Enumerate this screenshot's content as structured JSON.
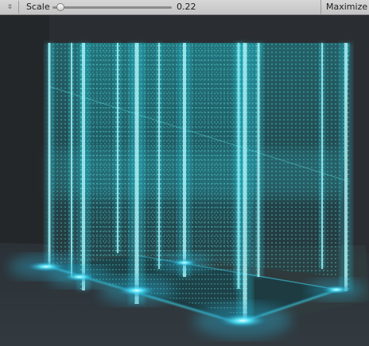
{
  "toolbar": {
    "stepper_icon": "stepper-arrows-icon",
    "scale_label": "Scale",
    "scale_value": "0.22",
    "scale_fraction": 0.03,
    "maximize_label": "Maximize O"
  },
  "viewport": {
    "description_colors": {
      "glow": "#3ff3ff",
      "floor": "#2f3439",
      "background": "#2a2d31"
    }
  }
}
